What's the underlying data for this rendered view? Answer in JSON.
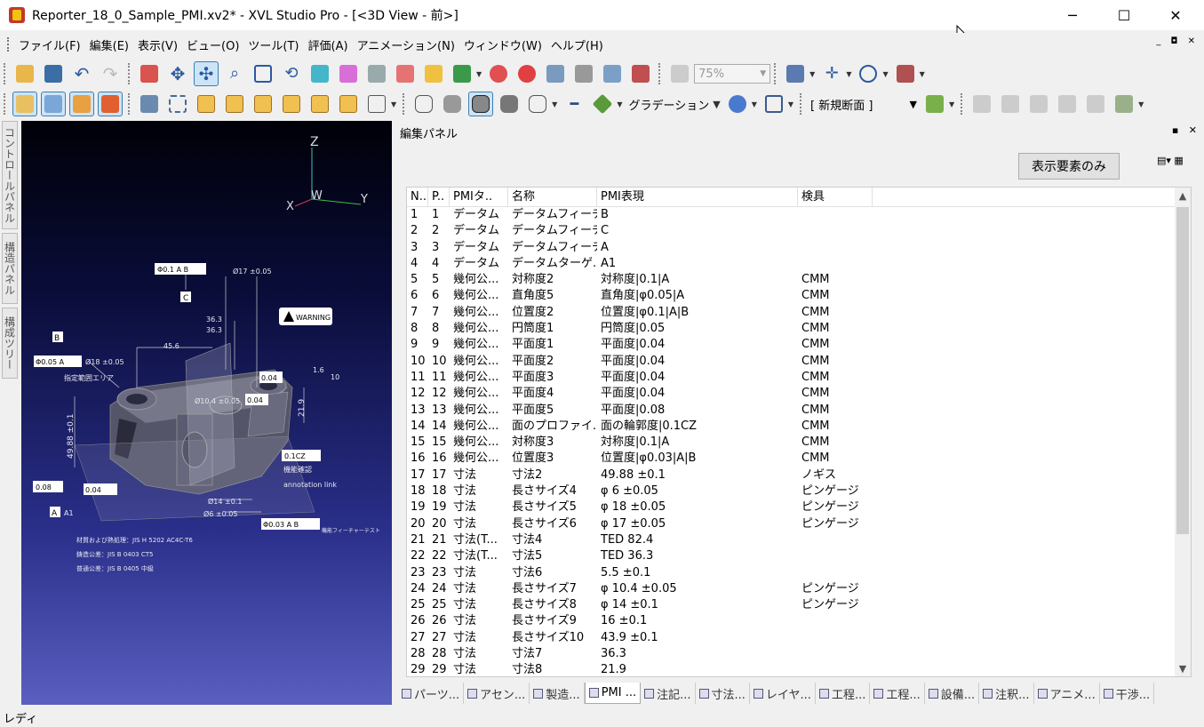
{
  "window": {
    "title": "Reporter_18_0_Sample_PMI.xv2* - XVL Studio Pro - [<3D View - 前>]",
    "minimize": "─",
    "maximize": "☐",
    "close": "✕"
  },
  "menu": {
    "items": [
      "ファイル(F)",
      "編集(E)",
      "表示(V)",
      "ビュー(O)",
      "ツール(T)",
      "評価(A)",
      "アニメーション(N)",
      "ウィンドウ(W)",
      "ヘルプ(H)"
    ],
    "mdi_controls": "_ ◘ ✕"
  },
  "toolbar1": {
    "zoom_value": "75%"
  },
  "toolbar2": {
    "gradation_label": "グラデーション",
    "section_value": "[ 新規断面 ]"
  },
  "left_tabs": [
    "コントロールパネル",
    "構造パネル",
    "構成ツリー"
  ],
  "panel": {
    "title": "編集パネル",
    "pins": "▪ ✕",
    "visible_only_button": "表示要素のみ",
    "columns": [
      "N..",
      "P..",
      "PMIタ..",
      "名称",
      "PMI表現",
      "検具"
    ],
    "rows": [
      [
        "1",
        "1",
        "データム",
        "データムフィーチ...",
        "B",
        ""
      ],
      [
        "2",
        "2",
        "データム",
        "データムフィーチ...",
        "C",
        ""
      ],
      [
        "3",
        "3",
        "データム",
        "データムフィーチ...",
        "A",
        ""
      ],
      [
        "4",
        "4",
        "データム",
        "データムターゲ...",
        "A1",
        ""
      ],
      [
        "5",
        "5",
        "幾何公...",
        "対称度2",
        "対称度|0.1|A",
        "CMM"
      ],
      [
        "6",
        "6",
        "幾何公...",
        "直角度5",
        "直角度|φ0.05|A",
        "CMM"
      ],
      [
        "7",
        "7",
        "幾何公...",
        "位置度2",
        "位置度|φ0.1|A|B",
        "CMM"
      ],
      [
        "8",
        "8",
        "幾何公...",
        "円筒度1",
        "円筒度|0.05",
        "CMM"
      ],
      [
        "9",
        "9",
        "幾何公...",
        "平面度1",
        "平面度|0.04",
        "CMM"
      ],
      [
        "10",
        "10",
        "幾何公...",
        "平面度2",
        "平面度|0.04",
        "CMM"
      ],
      [
        "11",
        "11",
        "幾何公...",
        "平面度3",
        "平面度|0.04",
        "CMM"
      ],
      [
        "12",
        "12",
        "幾何公...",
        "平面度4",
        "平面度|0.04",
        "CMM"
      ],
      [
        "13",
        "13",
        "幾何公...",
        "平面度5",
        "平面度|0.08",
        "CMM"
      ],
      [
        "14",
        "14",
        "幾何公...",
        "面のプロファイ...",
        "面の輪郭度|0.1CZ",
        "CMM"
      ],
      [
        "15",
        "15",
        "幾何公...",
        "対称度3",
        "対称度|0.1|A",
        "CMM"
      ],
      [
        "16",
        "16",
        "幾何公...",
        "位置度3",
        "位置度|φ0.03|A|B",
        "CMM"
      ],
      [
        "17",
        "17",
        "寸法",
        "寸法2",
        "49.88 ±0.1",
        "ノギス"
      ],
      [
        "18",
        "18",
        "寸法",
        "長さサイズ4",
        "φ 6 ±0.05",
        "ピンゲージ"
      ],
      [
        "19",
        "19",
        "寸法",
        "長さサイズ5",
        "φ 18 ±0.05",
        "ピンゲージ"
      ],
      [
        "20",
        "20",
        "寸法",
        "長さサイズ6",
        "φ 17 ±0.05",
        "ピンゲージ"
      ],
      [
        "21",
        "21",
        "寸法(T...",
        "寸法4",
        "TED 82.4",
        ""
      ],
      [
        "22",
        "22",
        "寸法(T...",
        "寸法5",
        "TED 36.3",
        ""
      ],
      [
        "23",
        "23",
        "寸法",
        "寸法6",
        "5.5 ±0.1",
        ""
      ],
      [
        "24",
        "24",
        "寸法",
        "長さサイズ7",
        "φ 10.4 ±0.05",
        "ピンゲージ"
      ],
      [
        "25",
        "25",
        "寸法",
        "長さサイズ8",
        "φ 14 ±0.1",
        "ピンゲージ"
      ],
      [
        "26",
        "26",
        "寸法",
        "長さサイズ9",
        "16 ±0.1",
        ""
      ],
      [
        "27",
        "27",
        "寸法",
        "長さサイズ10",
        "43.9 ±0.1",
        ""
      ],
      [
        "28",
        "28",
        "寸法",
        "寸法7",
        "36.3",
        ""
      ],
      [
        "29",
        "29",
        "寸法",
        "寸法8",
        "21.9",
        ""
      ]
    ]
  },
  "view3d": {
    "axis_z": "Z",
    "axis_w": "W",
    "axis_y": "Y",
    "axis_x": "X",
    "warning": "WARNING",
    "datum_b": "B",
    "datum_c": "C",
    "datum_a": "A",
    "datum_a1": "A1",
    "dim_17": "Ø17 ±0.05",
    "dim_363a": "36.3",
    "dim_363b": "36.3",
    "dim_456": "45.6",
    "dim_18": "Ø18 ±0.05",
    "dim_4988": "49.88 ±0.1",
    "dim_104": "Ø10.4 ±0.05",
    "dim_219": "21.9",
    "dim_14": "Ø14 ±0.1",
    "dim_6": "Ø6 ±0.05",
    "fcf_top": "Φ0.1 A B",
    "fcf_left": "Φ0.05 A",
    "fcf_004a": "0.04",
    "fcf_004b": "0.04",
    "fcf_008": "0.08",
    "fcf_cz": "0.1CZ",
    "fcf_bottom": "Φ0.03 A B",
    "rough_16": "1.6",
    "rough_10": "10",
    "area_label": "指定範囲エリア",
    "note_a": "機能確認",
    "note_b": "annotation link",
    "feature_test": "機能フィーチャーテスト",
    "material": "材質および熱処理：JIS H 5202  AC4C-T6",
    "general1": "鋳造公差：JIS B 0403  CT5",
    "general2": "普通公差：JIS B 0405  中級"
  },
  "bottom_tabs": [
    "パーツ...",
    "アセン...",
    "製造...",
    "PMI ...",
    "注記...",
    "寸法...",
    "レイヤ...",
    "工程...",
    "工程...",
    "設備...",
    "注釈...",
    "アニメ...",
    "干渉..."
  ],
  "status": {
    "text": "レディ"
  },
  "colors": {
    "accent": "#3c7fb1",
    "view_top": "#000008",
    "view_bottom": "#5a5fc0"
  }
}
